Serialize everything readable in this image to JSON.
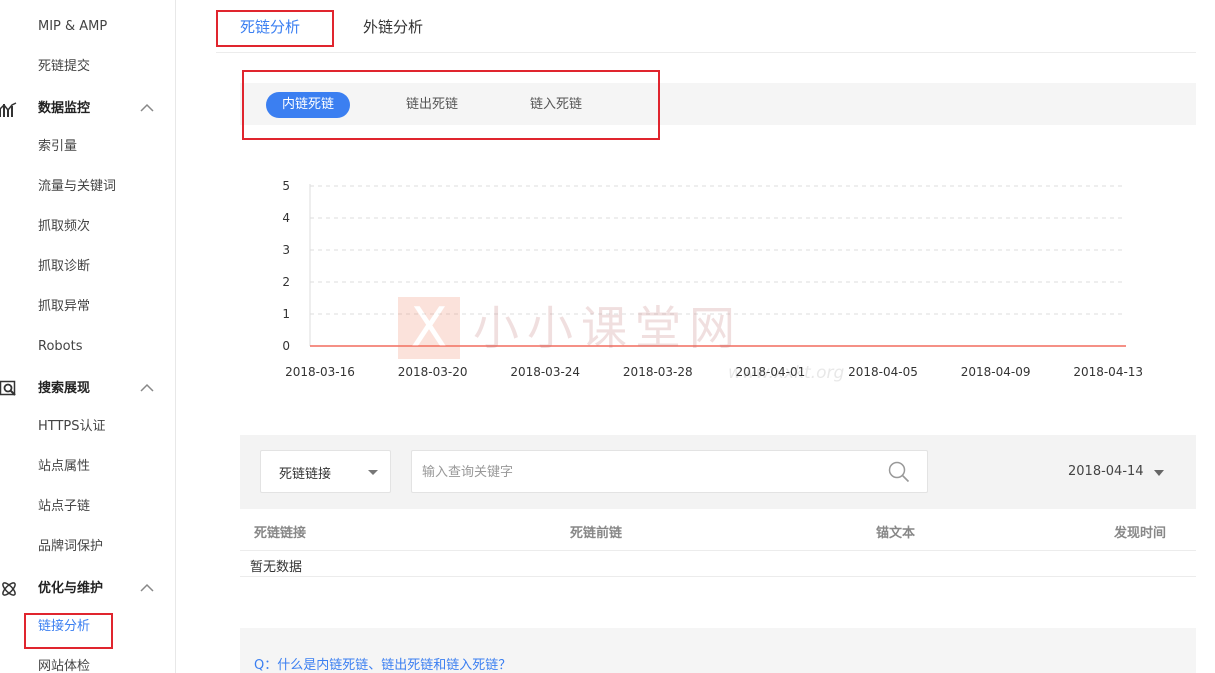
{
  "sidebar": {
    "items_top": [
      {
        "label": "MIP & AMP"
      },
      {
        "label": "死链提交"
      }
    ],
    "groups": [
      {
        "label": "数据监控",
        "icon": "bar-chart-icon",
        "items": [
          "索引量",
          "流量与关键词",
          "抓取频次",
          "抓取诊断",
          "抓取异常",
          "Robots"
        ]
      },
      {
        "label": "搜索展现",
        "icon": "search-display-icon",
        "items": [
          "HTTPS认证",
          "站点属性",
          "站点子链",
          "品牌词保护"
        ]
      },
      {
        "label": "优化与维护",
        "icon": "atom-icon",
        "items": [
          "链接分析",
          "网站体检"
        ]
      }
    ],
    "active_item": "链接分析"
  },
  "top_tabs": [
    "死链分析",
    "外链分析"
  ],
  "active_top_tab": "死链分析",
  "sub_tabs": [
    "内链死链",
    "链出死链",
    "链入死链"
  ],
  "active_sub_tab": "内链死链",
  "chart_data": {
    "type": "line",
    "x": [
      "2018-03-16",
      "2018-03-20",
      "2018-03-24",
      "2018-03-28",
      "2018-04-01",
      "2018-04-05",
      "2018-04-09",
      "2018-04-13"
    ],
    "series": [
      {
        "values": [
          0,
          0,
          0,
          0,
          0,
          0,
          0,
          0
        ],
        "color": "#f26c5f"
      }
    ],
    "y_ticks": [
      0,
      1,
      2,
      3,
      4,
      5
    ],
    "ylim": [
      0,
      5
    ],
    "grid": true,
    "grid_style": "dashed"
  },
  "watermark": {
    "box_glyph": "X",
    "text": "小小课堂网",
    "url": "www.xxkt.org"
  },
  "filter": {
    "type_select": "死链链接",
    "search_placeholder": "输入查询关键字",
    "date": "2018-04-14"
  },
  "table": {
    "columns": [
      "死链链接",
      "死链前链",
      "锚文本",
      "发现时间"
    ],
    "empty_text": "暂无数据"
  },
  "faq": {
    "question": "Q：什么是内链死链、链出死链和链入死链？"
  },
  "colors": {
    "accent": "#3b7ff1",
    "highlight_red": "#e0252e",
    "series_line": "#f26c5f"
  }
}
